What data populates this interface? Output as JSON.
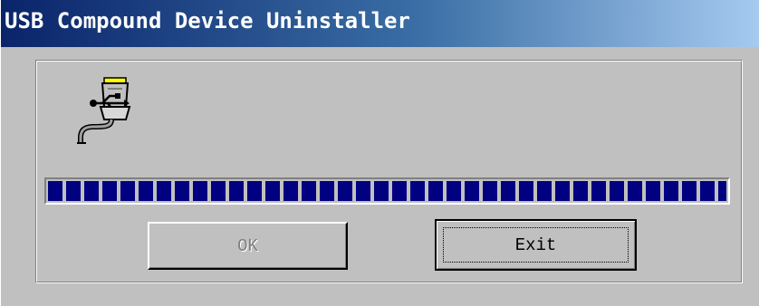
{
  "window": {
    "title": "USB Compound Device Uninstaller"
  },
  "icons": {
    "device": "usb-plug-icon"
  },
  "progress": {
    "value_fraction": 1.0
  },
  "buttons": {
    "ok_label": "OK",
    "ok_enabled": false,
    "exit_label": "Exit",
    "exit_focused": true
  },
  "colors": {
    "titlebar_start": "#0a246a",
    "titlebar_end": "#a6caf0",
    "face": "#c0c0c0",
    "progress_block": "#000080"
  }
}
